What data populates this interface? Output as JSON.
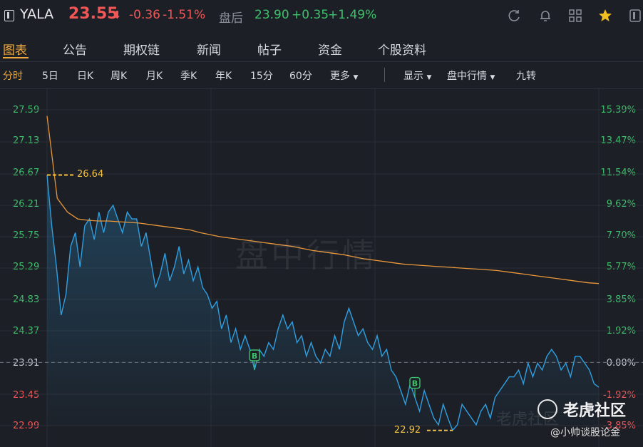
{
  "header": {
    "symbol": "YALA",
    "price": "23.55",
    "price_arrow": "⬇",
    "change": "-0.36",
    "change_pct": "-1.51%",
    "after_hours_label": "盘后",
    "after_hours_price": "23.90",
    "after_hours_change": "+0.35",
    "after_hours_change_pct": "+1.49%",
    "icons": [
      "refresh-icon",
      "bell-icon",
      "grid-icon",
      "star-icon",
      "back-icon"
    ]
  },
  "tabs": [
    "图表",
    "公告",
    "期权链",
    "新闻",
    "帖子",
    "资金",
    "个股资料"
  ],
  "periods": [
    "分时",
    "5日",
    "日K",
    "周K",
    "月K",
    "季K",
    "年K",
    "15分",
    "60分",
    "更多"
  ],
  "options": [
    "显示",
    "盘中行情",
    "九转"
  ],
  "watermark": "盘中行情",
  "brand": {
    "name": "老虎社区",
    "credit": "@小帅谈股论金",
    "faint": "老虎社区"
  },
  "colors": {
    "up": "#3fc06b",
    "down": "#f25757",
    "accent": "#f0a93c",
    "price_line": "#2f9fe0",
    "avg_line": "#e8963a"
  },
  "chart_data": {
    "type": "line",
    "prev_close": 23.91,
    "ylim": [
      22.99,
      27.59
    ],
    "y_ticks_left": [
      "27.59",
      "27.13",
      "26.67",
      "26.21",
      "25.75",
      "25.29",
      "24.83",
      "24.37",
      "23.91",
      "23.45",
      "22.99"
    ],
    "y_ticks_right": [
      "15.39%",
      "13.47%",
      "11.54%",
      "9.62%",
      "7.70%",
      "5.77%",
      "3.85%",
      "1.92%",
      "0.00%",
      "-1.92%",
      "-3.85%"
    ],
    "high_label": "26.64",
    "low_label": "22.92",
    "trade_markers": [
      "B",
      "B"
    ],
    "series": [
      {
        "values": [
          26.64,
          25.9,
          25.3,
          24.6,
          24.9,
          25.6,
          25.8,
          25.3,
          25.9,
          26.0,
          25.7,
          26.1,
          25.8,
          26.1,
          26.2,
          26.0,
          25.8,
          26.1,
          26.0,
          26.0,
          25.6,
          25.8,
          25.4,
          25.0,
          25.2,
          25.5,
          25.1,
          25.3,
          25.6,
          25.2,
          25.4,
          25.1,
          25.3,
          25.0,
          24.9,
          24.7,
          24.8,
          24.4,
          24.6,
          24.2,
          24.4,
          24.1,
          24.3,
          24.1,
          23.8,
          24.1,
          24.0,
          24.2,
          24.1,
          24.4,
          24.6,
          24.4,
          24.5,
          24.2,
          24.3,
          24.0,
          24.2,
          24.0,
          23.9,
          24.1,
          24.0,
          24.3,
          24.1,
          24.5,
          24.7,
          24.5,
          24.3,
          24.4,
          24.2,
          24.1,
          24.3,
          24.0,
          24.1,
          23.8,
          23.7,
          23.5,
          23.3,
          23.6,
          23.4,
          23.2,
          23.5,
          23.3,
          23.1,
          23.0,
          23.3,
          23.1,
          22.92,
          23.0,
          23.3,
          23.2,
          23.1,
          23.0,
          23.2,
          23.3,
          23.1,
          23.4,
          23.5,
          23.6,
          23.7,
          23.7,
          23.8,
          23.6,
          23.9,
          23.7,
          23.9,
          23.8,
          24.0,
          24.1,
          24.0,
          23.8,
          23.9,
          23.7,
          24.0,
          24.0,
          23.9,
          23.8,
          23.6,
          23.55
        ]
      },
      {
        "values": [
          27.5,
          26.3,
          26.1,
          26.0,
          25.98,
          25.97,
          25.97,
          25.96,
          25.95,
          25.94,
          25.92,
          25.9,
          25.88,
          25.86,
          25.84,
          25.8,
          25.77,
          25.74,
          25.72,
          25.7,
          25.68,
          25.66,
          25.64,
          25.62,
          25.6,
          25.57,
          25.54,
          25.52,
          25.5,
          25.48,
          25.45,
          25.42,
          25.4,
          25.38,
          25.36,
          25.34,
          25.33,
          25.32,
          25.31,
          25.3,
          25.29,
          25.28,
          25.27,
          25.26,
          25.25,
          25.23,
          25.21,
          25.19,
          25.17,
          25.15,
          25.13,
          25.11,
          25.09,
          25.07,
          25.06
        ]
      }
    ]
  }
}
